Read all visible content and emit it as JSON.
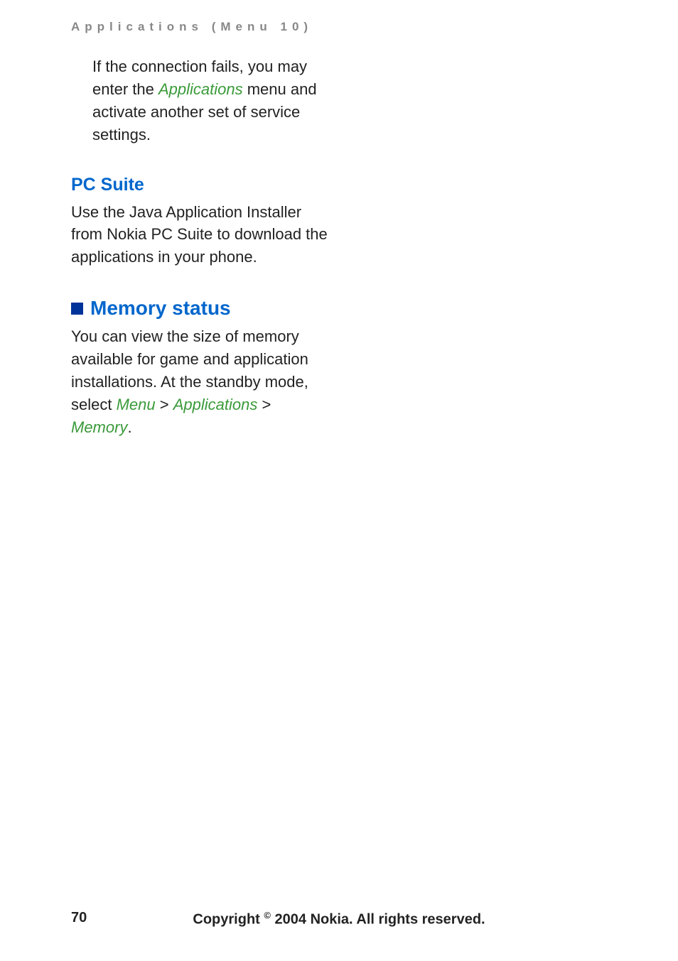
{
  "header": {
    "title": "Applications (Menu 10)"
  },
  "intro": {
    "pre": "If the connection fails, you may enter the ",
    "link": "Applications",
    "post": " menu and activate another set of service settings."
  },
  "section1": {
    "heading": "PC Suite",
    "body": "Use the Java Application Installer from Nokia PC Suite to download the applications in your phone."
  },
  "section2": {
    "heading": "Memory status",
    "body_pre": "You can view the size of memory available for game and application installations. At the standby mode, select ",
    "menu": "Menu",
    "sep1": " > ",
    "apps": "Applications",
    "sep2": " > ",
    "memory": "Memory",
    "period": "."
  },
  "footer": {
    "page": "70",
    "copyright_pre": "Copyright ",
    "copyright_sym": "©",
    "copyright_post": " 2004 Nokia. All rights reserved."
  }
}
